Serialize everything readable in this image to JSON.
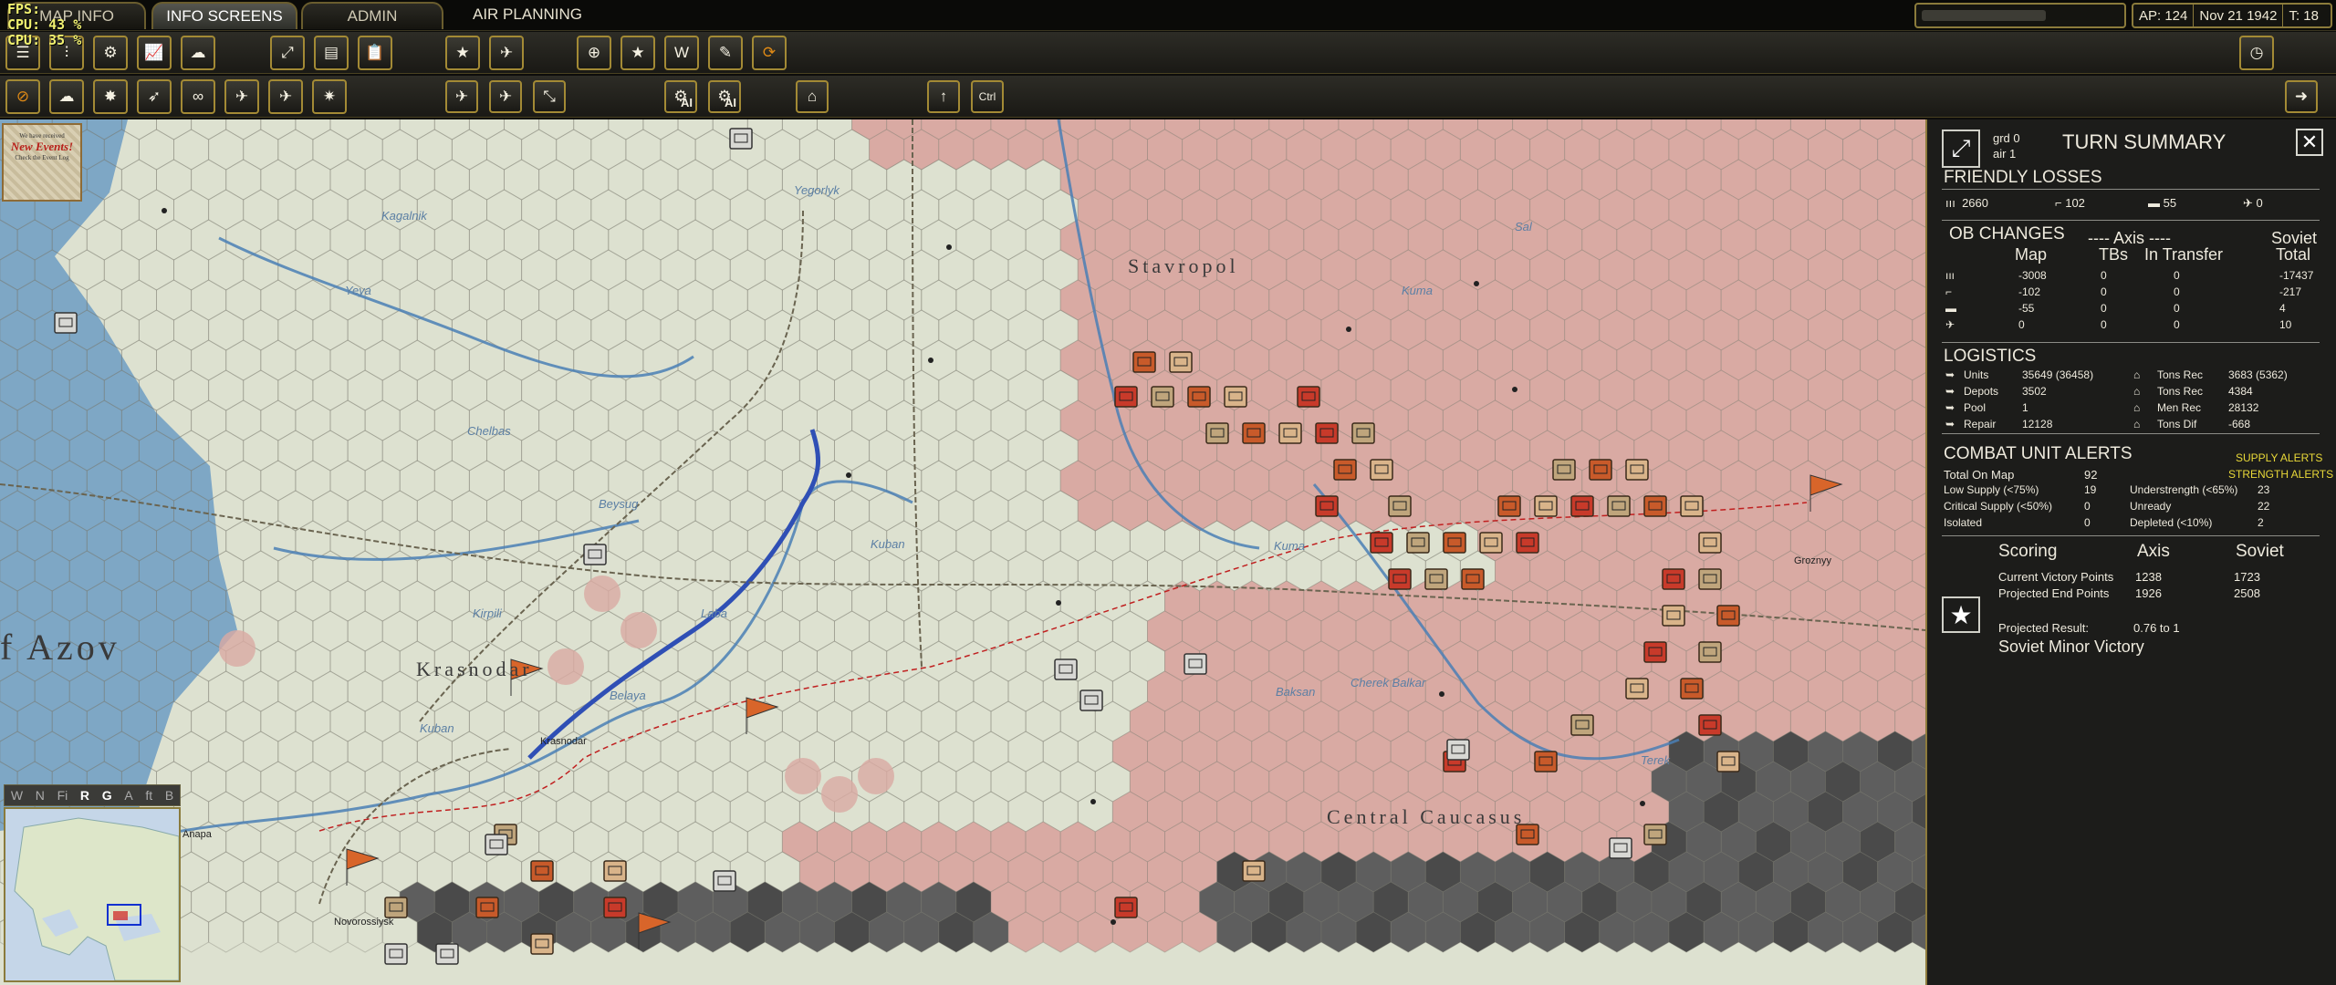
{
  "debug": {
    "fps": "FPS:",
    "cpu1": "CPU: 43 %",
    "cpu2": "CPU: 35 %"
  },
  "tabs": [
    {
      "label": "MAP INFO"
    },
    {
      "label": "INFO SCREENS"
    },
    {
      "label": "ADMIN"
    }
  ],
  "air_planning": "AIR PLANNING",
  "status": {
    "ap": "AP: 124",
    "date": "Nov 21 1942",
    "turn": "T: 18"
  },
  "toolbar": {
    "ai_label": "AI",
    "ctrl_label": "Ctrl"
  },
  "new_events": {
    "line1": "We have received",
    "line2": "New Events!",
    "line3": "Check the Event Log"
  },
  "map_filters": [
    "W",
    "N",
    "Fi",
    "R",
    "G",
    "A",
    "ft",
    "B"
  ],
  "map_labels": {
    "azov": "f Azov",
    "krasnodar": "Krasnodar",
    "stavropol": "Stavropol",
    "caucasus": "Central Caucasus"
  },
  "rivers": [
    "Kagalnik",
    "Yeya",
    "Chelbas",
    "Beysug",
    "Kirpili",
    "Laba",
    "Belaya",
    "Kuban",
    "Kuban",
    "Kuma",
    "Kuma",
    "Baksan",
    "Cherek Balkar",
    "Terek",
    "Sal",
    "Yegorlyk"
  ],
  "towns": [
    "Krasnodar",
    "Novorossiysk",
    "Groznyy",
    "Anapa"
  ],
  "summary": {
    "title": "TURN SUMMARY",
    "grd": "grd 0",
    "air": "air 1",
    "friendly_losses": "FRIENDLY LOSSES",
    "losses": [
      "2660",
      "102",
      "55",
      "0"
    ],
    "ob_changes": "OB CHANGES",
    "axis_hdr": "---- Axis ----",
    "soviet_hdr": "Soviet",
    "cols": [
      "Map",
      "TBs",
      "In Transfer",
      "Total"
    ],
    "ob_rows": [
      [
        "-3008",
        "0",
        "0",
        "-17437"
      ],
      [
        "-102",
        "0",
        "0",
        "-217"
      ],
      [
        "-55",
        "0",
        "0",
        "4"
      ],
      [
        "0",
        "0",
        "0",
        "10"
      ]
    ],
    "logistics": "LOGISTICS",
    "log_left": [
      [
        "Units",
        "35649 (36458)"
      ],
      [
        "Depots",
        "3502"
      ],
      [
        "Pool",
        "1"
      ],
      [
        "Repair",
        "12128"
      ]
    ],
    "log_right": [
      [
        "Tons Rec",
        "3683 (5362)"
      ],
      [
        "Tons Rec",
        "4384"
      ],
      [
        "Men Rec",
        "28132"
      ],
      [
        "Tons Dif",
        "-668"
      ]
    ],
    "alerts": "COMBAT UNIT ALERTS",
    "supply_alerts": "SUPPLY ALERTS",
    "strength_alert": "STRENGTH ALERTS",
    "total_on_map": "Total On Map",
    "total_on_map_v": "92",
    "alerts_left": [
      [
        "Low Supply  (<75%)",
        "19"
      ],
      [
        "Critical Supply  (<50%)",
        "0"
      ],
      [
        "Isolated",
        "0"
      ]
    ],
    "alerts_right": [
      [
        "Understrength  (<65%)",
        "23"
      ],
      [
        "Unready",
        "22"
      ],
      [
        "Depleted  (<10%)",
        "2"
      ]
    ],
    "scoring": "Scoring",
    "axis": "Axis",
    "soviet": "Soviet",
    "cvp": "Current Victory Points",
    "cvp_axis": "1238",
    "cvp_sov": "1723",
    "pep": "Projected End Points",
    "pep_axis": "1926",
    "pep_sov": "2508",
    "proj": "Projected Result:",
    "proj_v": "0.76  to  1",
    "result": "Soviet Minor Victory"
  },
  "colors": {
    "soviet_zone": "#d9aaa3",
    "axis_zone": "#dde1d0",
    "mountain": "#5b5b5b",
    "water": "#7ea7c5",
    "panel_bg": "#1c1c1a",
    "gold_border": "#a38a35",
    "alert_yellow": "#e8d838"
  }
}
